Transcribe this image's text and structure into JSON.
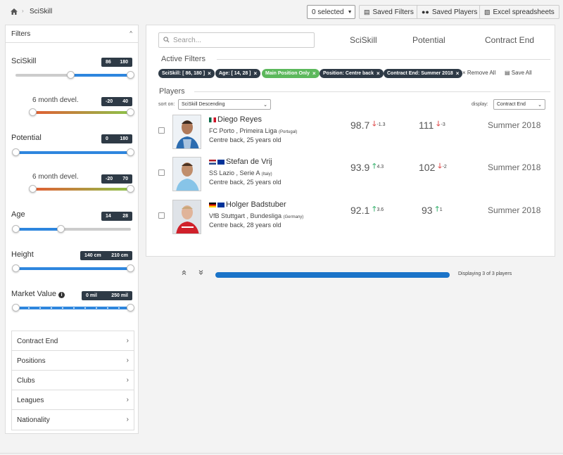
{
  "breadcrumb": {
    "home_icon": "home-icon",
    "separator": "›",
    "current": "SciSkill"
  },
  "toolbar": {
    "selected_label": "0 selected",
    "saved_filters": "Saved Filters",
    "saved_players": "Saved Players",
    "excel": "Excel spreadsheets"
  },
  "sidebar": {
    "title": "Filters",
    "collapse_icon": "^",
    "sciskill": {
      "label": "SciSkill",
      "min": "86",
      "max": "180",
      "range": [
        86,
        180
      ]
    },
    "sciskill_devel": {
      "label": "6 month devel.",
      "min": "-20",
      "max": "40",
      "range": [
        -20,
        40
      ]
    },
    "potential": {
      "label": "Potential",
      "min": "0",
      "max": "180",
      "range": [
        0,
        180
      ]
    },
    "potential_devel": {
      "label": "6 month devel.",
      "min": "-20",
      "max": "70",
      "range": [
        -20,
        70
      ]
    },
    "age": {
      "label": "Age",
      "min": "14",
      "max": "28",
      "range": [
        14,
        28
      ]
    },
    "height": {
      "label": "Height",
      "min": "140 cm",
      "max": "210 cm",
      "range": [
        140,
        210
      ]
    },
    "market_value": {
      "label": "Market Value",
      "min": "0 mil",
      "max": "250 mil",
      "range": [
        0,
        250
      ],
      "info_icon": "info-icon"
    },
    "accordion": [
      {
        "label": "Contract End"
      },
      {
        "label": "Positions"
      },
      {
        "label": "Clubs"
      },
      {
        "label": "Leagues"
      },
      {
        "label": "Nationality"
      }
    ],
    "chevron": "›"
  },
  "main": {
    "search_placeholder": "Search...",
    "columns": {
      "sciskill": "SciSkill",
      "potential": "Potential",
      "contract_end": "Contract End"
    },
    "active_filters_title": "Active Filters",
    "chips": [
      {
        "label": "SciSkill: [ 86, 180 ]",
        "x": "×"
      },
      {
        "label": "Age: [ 14, 28 ]",
        "x": "×"
      },
      {
        "label": "Main Position Only",
        "x": "×"
      },
      {
        "label": "Position: Centre back",
        "x": "×"
      },
      {
        "label": "Contract End: Summer 2018",
        "x": "×"
      }
    ],
    "remove_all": "× Remove All",
    "save_all": "Save All",
    "players_title": "Players",
    "sort_label": "sort on:",
    "sort_value": "SciSkill Descending",
    "display_label": "display:",
    "display_value": "Contract End",
    "players": [
      {
        "name": "Diego Reyes",
        "flag": "mexico",
        "club": "FC Porto , Primeira Liga",
        "country": "(Portugal)",
        "position": "Centre back, 25 years old",
        "sciskill": "98.7",
        "sciskill_dir": "down",
        "sciskill_delta": "-1.3",
        "potential": "111",
        "potential_dir": "down",
        "potential_delta": "-3",
        "contract_end": "Summer 2018"
      },
      {
        "name": "Stefan de Vrij",
        "flag": "netherlands",
        "club": "SS Lazio , Serie A",
        "country": "(Italy)",
        "position": "Centre back, 25 years old",
        "sciskill": "93.9",
        "sciskill_dir": "up",
        "sciskill_delta": "4.3",
        "potential": "102",
        "potential_dir": "down",
        "potential_delta": "-2",
        "contract_end": "Summer 2018"
      },
      {
        "name": "Holger Badstuber",
        "flag": "germany",
        "club": "VfB Stuttgart , Bundesliga",
        "country": "(Germany)",
        "position": "Centre back, 28 years old",
        "sciskill": "92.1",
        "sciskill_dir": "up",
        "sciskill_delta": "3.6",
        "potential": "93",
        "potential_dir": "up",
        "potential_delta": "1",
        "contract_end": "Summer 2018"
      }
    ]
  },
  "pager": {
    "up_icon": "«",
    "down_icon": "»",
    "progress": 1.0,
    "count_text": "Displaying 3 of 3 players"
  },
  "colors": {
    "accent": "#1a73c8",
    "badge": "#2e3a46",
    "green": "#5cb85c",
    "up": "#3cb371",
    "down": "#e05050"
  }
}
